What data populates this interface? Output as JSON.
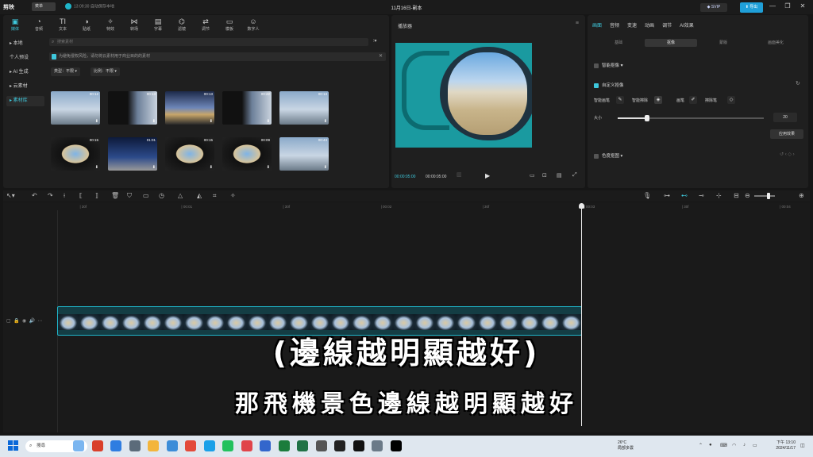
{
  "titlebar": {
    "logo_text": "剪映",
    "menu_label": "菜单",
    "save_status": "13:09:30 自动保存本地",
    "project_title": "11月16日-副本",
    "vip_label": "SVIP",
    "export_label": "导出",
    "minimize_icon": "—",
    "maximize_icon": "❐",
    "close_icon": "✕"
  },
  "media_toolbar": {
    "tabs": [
      {
        "label": "媒体",
        "icon": "▣"
      },
      {
        "label": "音频",
        "icon": "◔"
      },
      {
        "label": "文本",
        "icon": "TI"
      },
      {
        "label": "贴纸",
        "icon": "◑"
      },
      {
        "label": "特效",
        "icon": "✧"
      },
      {
        "label": "转场",
        "icon": "⋈"
      },
      {
        "label": "字幕",
        "icon": "▤"
      },
      {
        "label": "滤镜",
        "icon": "⌬"
      },
      {
        "label": "调节",
        "icon": "⇄"
      },
      {
        "label": "模板",
        "icon": "▭"
      },
      {
        "label": "数字人",
        "icon": "☺"
      }
    ]
  },
  "media_sidebar": {
    "items": [
      "▸ 本地",
      "个人预设",
      "▸ AI 生成",
      "▸ 云素材",
      "▸ 素材库"
    ]
  },
  "media_search": {
    "placeholder": "搜索素材",
    "filter_icon": "⫶▾"
  },
  "media_notice": {
    "text": "为避免侵权风险，请勿将云素材用于商业目的的素材"
  },
  "media_filters": {
    "type_label": "类型：不限 ▾",
    "ratio_label": "比例：不限 ▾"
  },
  "media_thumbs": [
    {
      "duration": "00:12",
      "style": "th-sky"
    },
    {
      "duration": "00:13",
      "style": "th-dark"
    },
    {
      "duration": "00:13",
      "style": "th-wide"
    },
    {
      "duration": "00:22",
      "style": "th-dark"
    },
    {
      "duration": "00:13",
      "style": "th-sky"
    },
    {
      "duration": "00:15",
      "style": "th-window"
    },
    {
      "duration": "01:01",
      "style": "th-night"
    },
    {
      "duration": "00:15",
      "style": "th-window"
    },
    {
      "duration": "00:09",
      "style": "th-window"
    },
    {
      "duration": "00:43",
      "style": "th-sky"
    }
  ],
  "player": {
    "title": "播放器",
    "menu_icon": "≡",
    "current_time": "00:00:05:00",
    "total_time": "00:00:05:00",
    "play_icon": "▶"
  },
  "props": {
    "tabs": [
      "画面",
      "音频",
      "变速",
      "动画",
      "调节",
      "AI效果"
    ],
    "active_tab": 0,
    "sub_tabs": [
      "基础",
      "抠像",
      "蒙版",
      "画面美化"
    ],
    "active_sub_tab": 1,
    "smart_cutout": "智能抠像 ♥",
    "custom_cutout": "自定义抠像",
    "tools": [
      "智能画笔",
      "智能擦除",
      "画笔",
      "擦除笔"
    ],
    "size_label": "大小",
    "size_value": "20",
    "size_fraction": 0.2,
    "apply_label": "应用效果",
    "chroma_key": "色度抠图 ▾"
  },
  "timeline": {
    "ticks": [
      {
        "label": "| 30f",
        "pos": 0.03
      },
      {
        "label": "| 00:01",
        "pos": 0.165
      },
      {
        "label": "| 30f",
        "pos": 0.3
      },
      {
        "label": "| 00:02",
        "pos": 0.43
      },
      {
        "label": "| 30f",
        "pos": 0.565
      },
      {
        "label": "| 00:03",
        "pos": 0.7
      },
      {
        "label": "| 30f",
        "pos": 0.83
      },
      {
        "label": "| 00:04",
        "pos": 0.96
      }
    ],
    "zoom_fraction": 0.7
  },
  "subtitles": {
    "line1": "(邊線越明顯越好)",
    "line2": "那飛機景色邊線越明顯越好"
  },
  "taskbar": {
    "search_label": "搜尋",
    "weather_temp": "26°C",
    "weather_desc": "局部多雲",
    "time": "下午 13:10",
    "date": "2024/11/17"
  }
}
